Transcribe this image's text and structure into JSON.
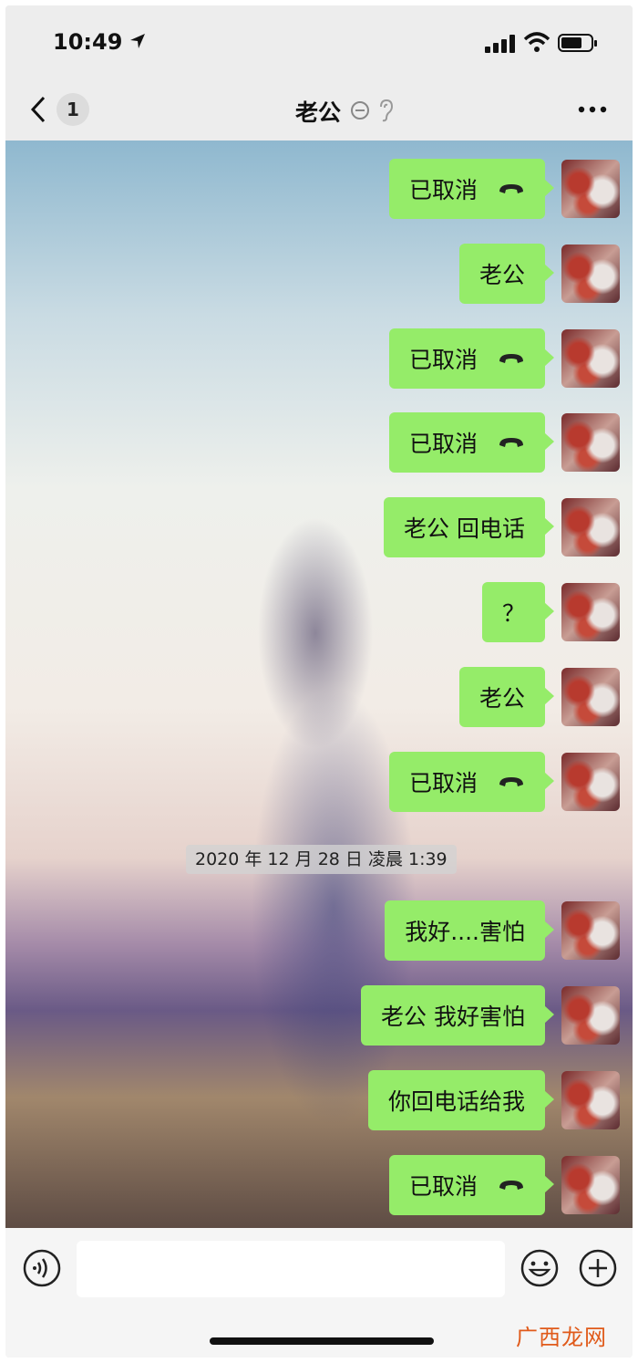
{
  "status": {
    "time": "10:49"
  },
  "nav": {
    "unread": "1",
    "title": "老公"
  },
  "messages": [
    {
      "text": "已取消",
      "call": true
    },
    {
      "text": "老公",
      "call": false
    },
    {
      "text": "已取消",
      "call": true
    },
    {
      "text": "已取消",
      "call": true
    },
    {
      "text": "老公 回电话",
      "call": false
    },
    {
      "text": "？",
      "call": false
    },
    {
      "text": "老公",
      "call": false
    },
    {
      "text": "已取消",
      "call": true
    },
    {
      "text": "我好....害怕",
      "call": false
    },
    {
      "text": "老公 我好害怕",
      "call": false
    },
    {
      "text": "你回电话给我",
      "call": false
    },
    {
      "text": "已取消",
      "call": true
    }
  ],
  "timestamp": "2020 年 12 月 28 日 凌晨 1:39",
  "watermark": "广西龙网",
  "colors": {
    "bubble": "#95ec69",
    "bg": "#ededed"
  },
  "icons": {
    "back": "chevron-left-icon",
    "mute": "mute-icon",
    "ear": "ear-icon",
    "more": "more-icon",
    "voice": "voice-icon",
    "emoji": "emoji-icon",
    "plus": "plus-icon",
    "call": "call-cancelled-icon"
  }
}
